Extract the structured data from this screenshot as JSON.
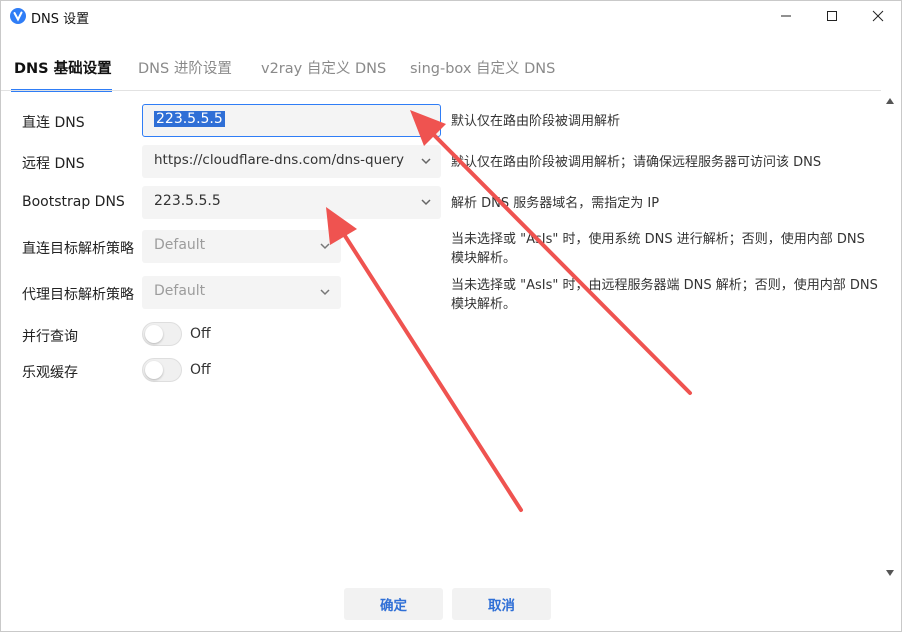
{
  "window": {
    "title": "DNS 设置",
    "brand_color": "#2f7df6"
  },
  "tabs": [
    {
      "label": "DNS 基础设置",
      "active": true
    },
    {
      "label": "DNS 进阶设置",
      "active": false
    },
    {
      "label": "v2ray 自定义 DNS",
      "active": false
    },
    {
      "label": "sing-box 自定义 DNS",
      "active": false
    }
  ],
  "form": {
    "direct_dns": {
      "label": "直连 DNS",
      "value": "223.5.5.5",
      "hint": "默认仅在路由阶段被调用解析"
    },
    "remote_dns": {
      "label": "远程 DNS",
      "value": "https://cloudflare-dns.com/dns-query",
      "hint": "默认仅在路由阶段被调用解析；请确保远程服务器可访问该 DNS"
    },
    "bootstrap_dns": {
      "label": "Bootstrap DNS",
      "value": "223.5.5.5",
      "hint": "解析 DNS 服务器域名，需指定为 IP"
    },
    "direct_strategy": {
      "label": "直连目标解析策略",
      "value": "Default",
      "hint": "当未选择或 \"AsIs\" 时，使用系统 DNS 进行解析；否则，使用内部 DNS 模块解析。"
    },
    "proxy_strategy": {
      "label": "代理目标解析策略",
      "value": "Default",
      "hint": "当未选择或 \"AsIs\" 时，由远程服务器端 DNS 解析；否则，使用内部 DNS 模块解析。"
    },
    "parallel_query": {
      "label": "并行查询",
      "state": "Off"
    },
    "optimistic_cache": {
      "label": "乐观缓存",
      "state": "Off"
    }
  },
  "buttons": {
    "ok": "确定",
    "cancel": "取消"
  },
  "icons": {
    "app": "v-logo-icon",
    "minimize": "minimize-icon",
    "maximize": "maximize-icon",
    "close": "close-icon",
    "dropdown": "chevron-down-icon",
    "scroll_up": "scroll-up-icon",
    "scroll_down": "scroll-down-icon"
  },
  "annotation_color": "#ef5350"
}
